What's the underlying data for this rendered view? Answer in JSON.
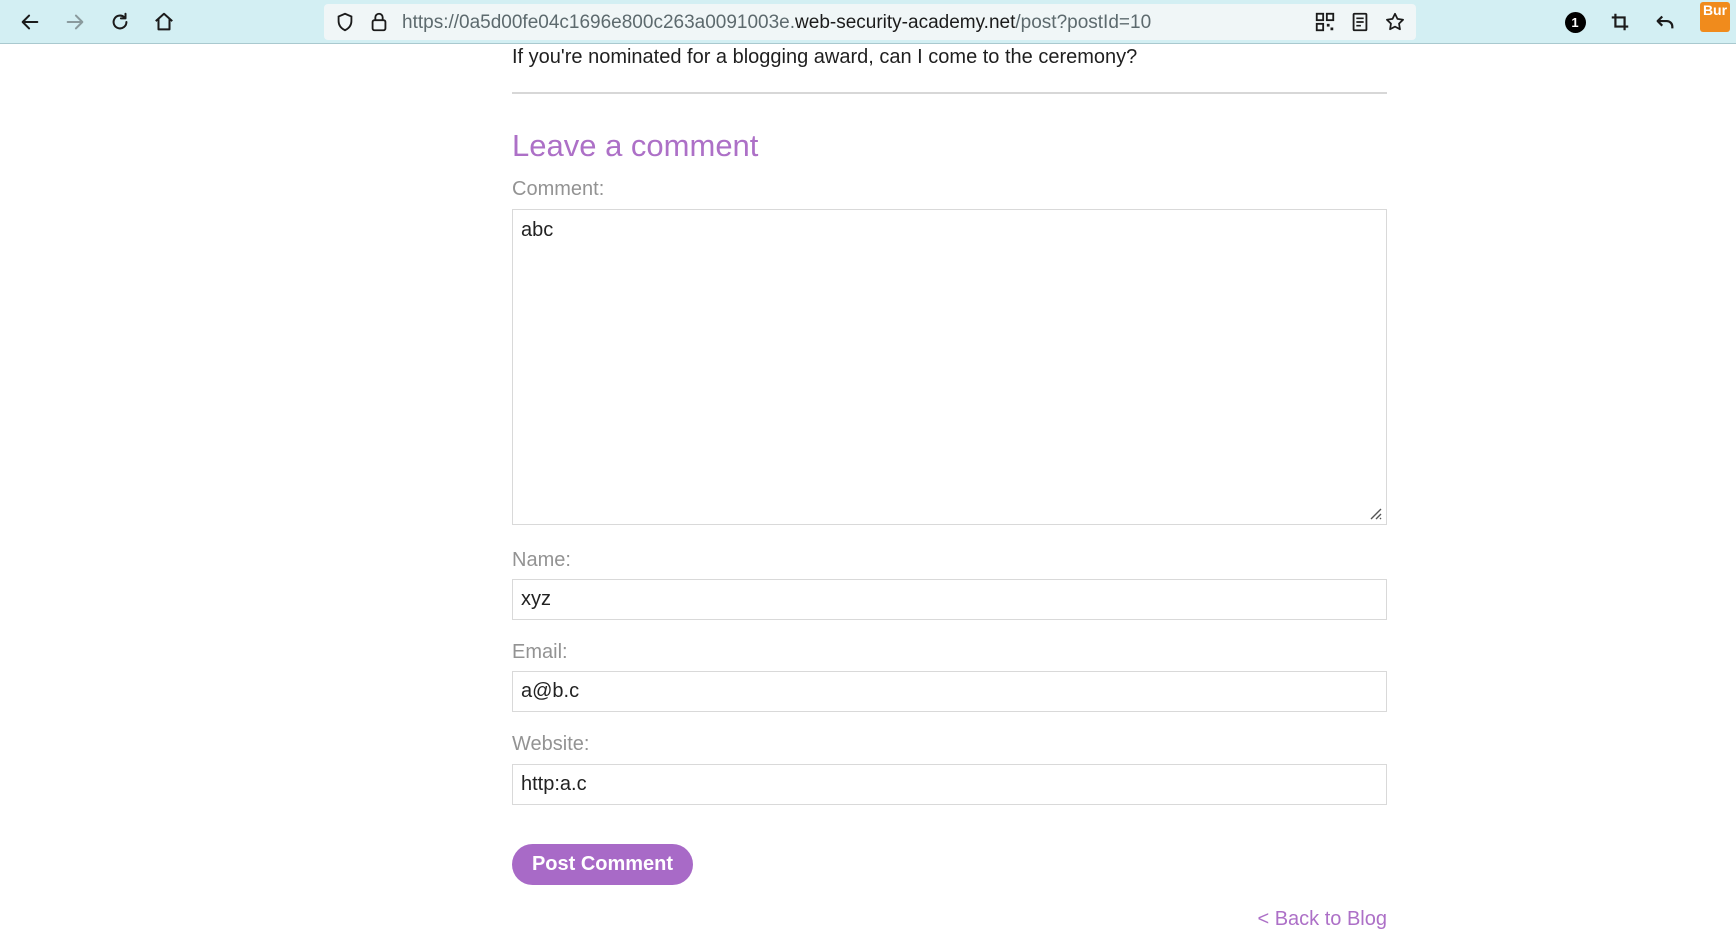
{
  "browser": {
    "url_prefix": "https://0a5d00fe04c1696e800c263a0091003e.",
    "url_domain": "web-security-academy.net",
    "url_path": "/post?postId=10",
    "notification_count": "1",
    "burp_label": "Bur"
  },
  "post": {
    "intro_text": "If you're nominated for a blogging award, can I come to the ceremony?"
  },
  "comment_form": {
    "title": "Leave a comment",
    "comment_label": "Comment:",
    "comment_value": "abc",
    "name_label": "Name:",
    "name_value": "xyz",
    "email_label": "Email:",
    "email_value": "a@b.c",
    "website_label": "Website:",
    "website_value": "http:a.c",
    "submit_label": "Post Comment"
  },
  "navigation": {
    "back_link": "< Back to Blog"
  },
  "colors": {
    "accent": "#ad70c7",
    "button": "#a86ac7",
    "toolbar": "#d3eff3"
  }
}
